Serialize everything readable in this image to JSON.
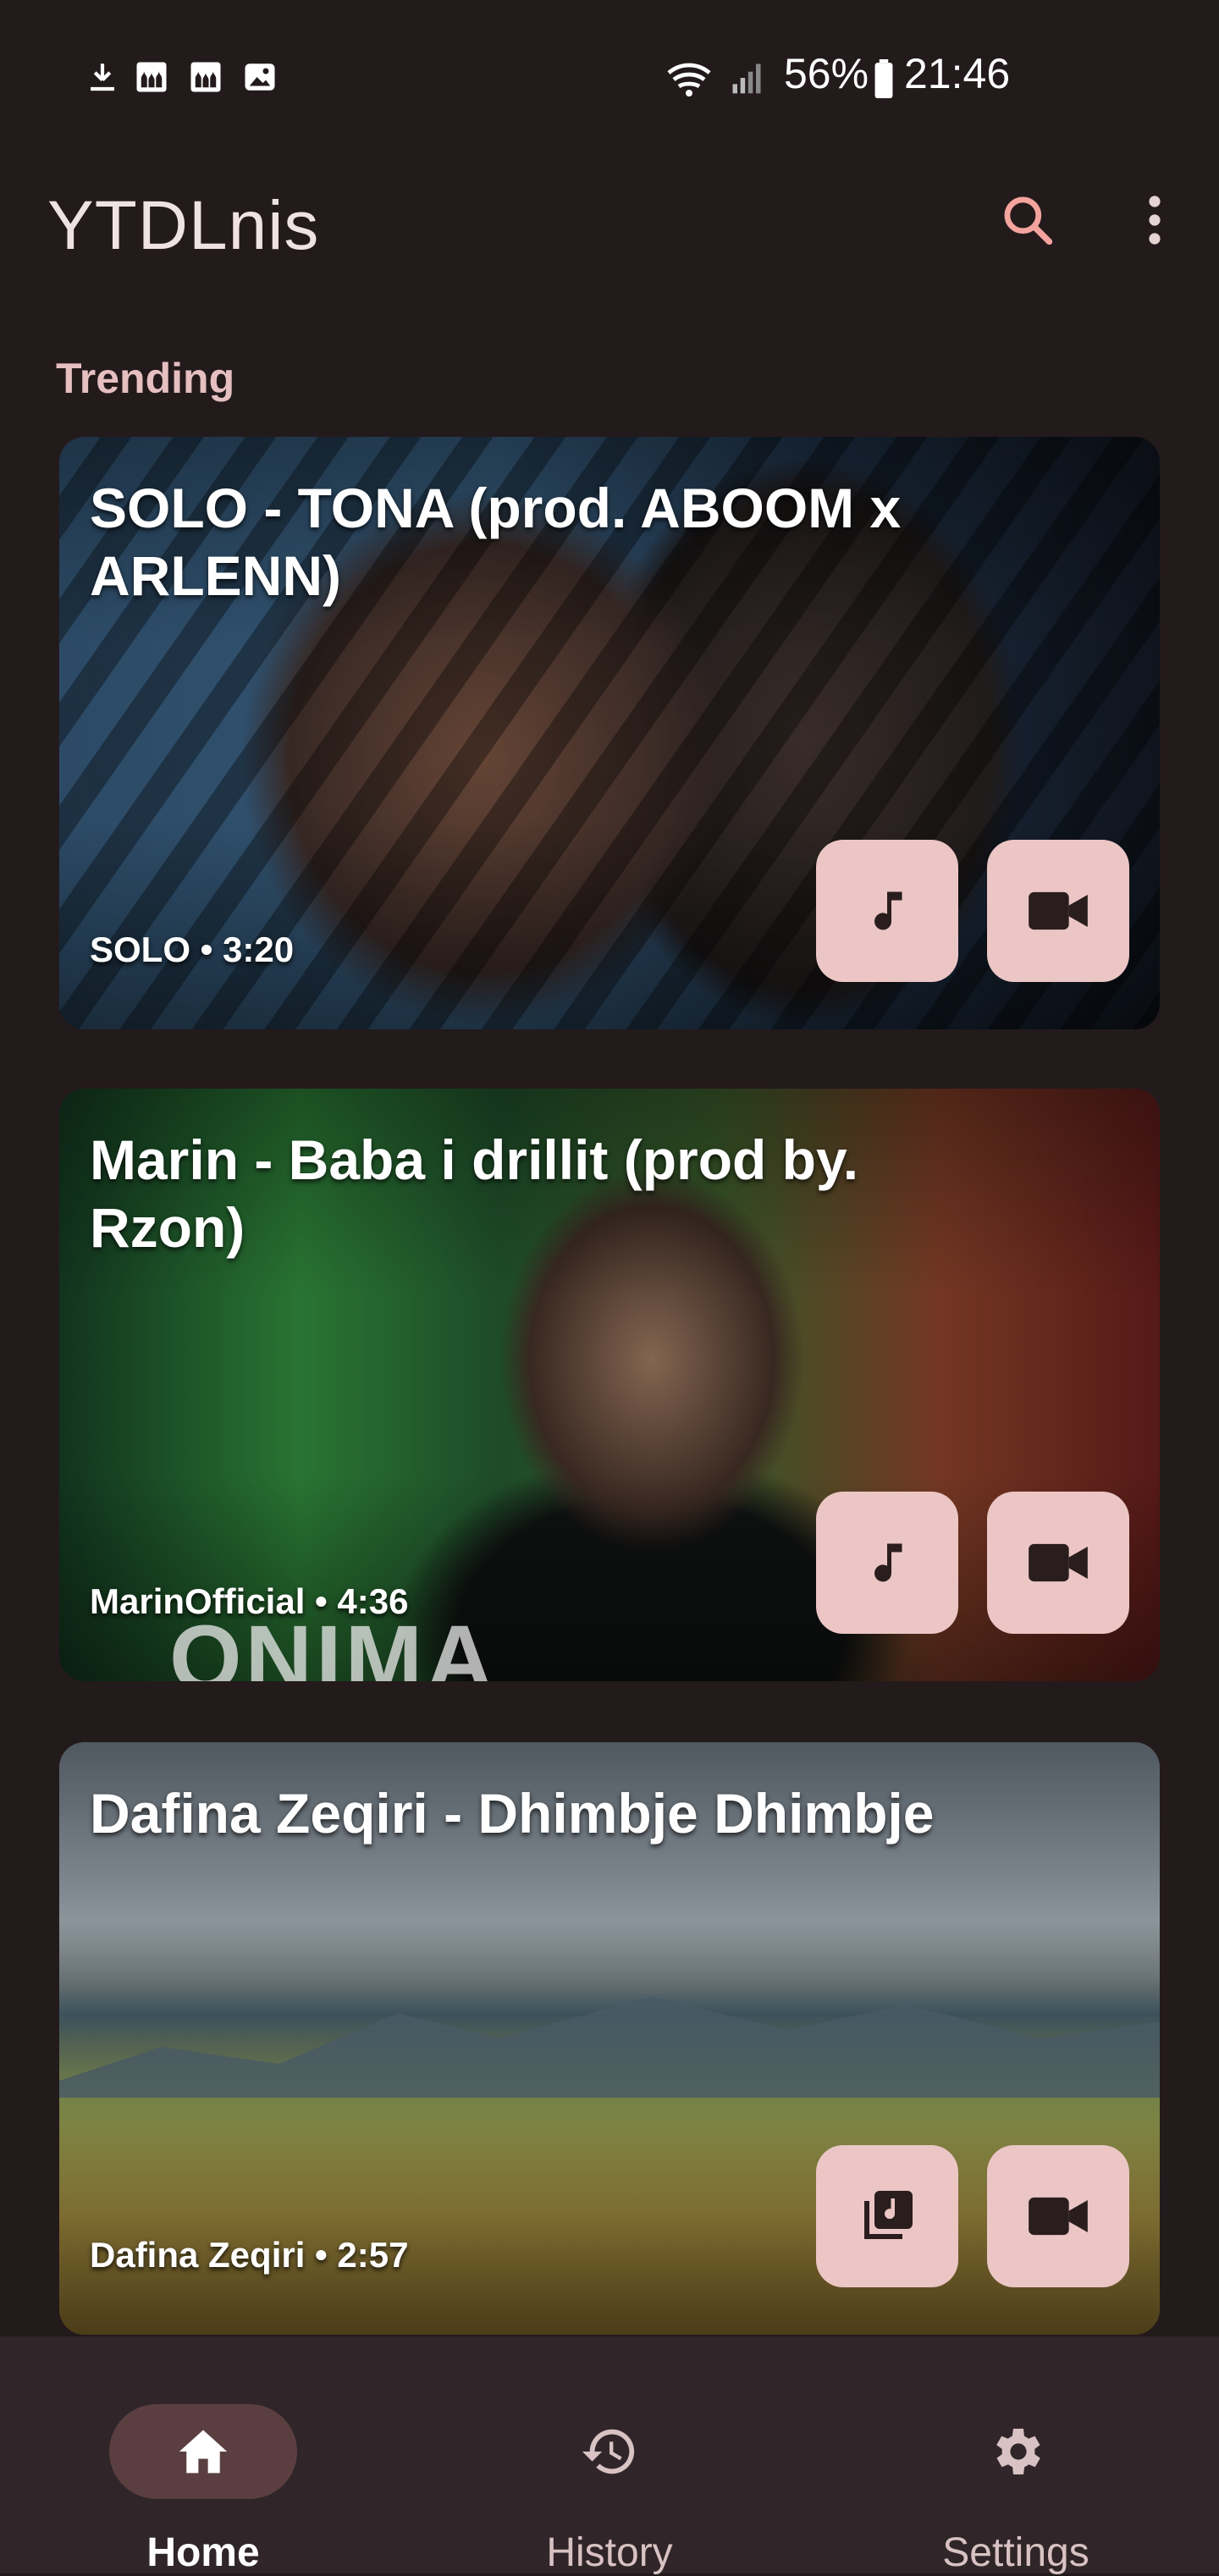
{
  "status_bar": {
    "battery": "56%",
    "time": "21:46",
    "icons": [
      "download-icon",
      "notification-mosque-icon",
      "notification-mosque-icon",
      "image-icon",
      "wifi-icon",
      "signal-icon",
      "battery-icon"
    ]
  },
  "app_bar": {
    "title": "YTDLnis",
    "search_icon": "search-icon",
    "menu_icon": "more-vert-icon"
  },
  "section": {
    "title": "Trending"
  },
  "cards": [
    {
      "title": "SOLO - TONA (prod. ABOOM x ARLENN)",
      "meta": "SOLO • 3:20",
      "audio_icon": "music-note-icon",
      "video_icon": "videocam-icon"
    },
    {
      "title": "Marin - Baba i drillit (prod by. Rzon)",
      "meta": "MarinOfficial • 4:36",
      "audio_icon": "music-note-icon",
      "video_icon": "videocam-icon"
    },
    {
      "title": "Dafina Zeqiri - Dhimbje Dhimbje",
      "meta": "Dafina Zeqiri • 2:57",
      "audio_icon": "music-library-icon",
      "video_icon": "videocam-icon"
    }
  ],
  "bottom_nav": {
    "items": [
      {
        "label": "Home",
        "icon": "home-icon",
        "active": true
      },
      {
        "label": "History",
        "icon": "history-icon",
        "active": false
      },
      {
        "label": "Settings",
        "icon": "settings-icon",
        "active": false
      }
    ]
  },
  "colors": {
    "background": "#231a1b",
    "accent": "#ebc6c4",
    "accent_icon": "#f4a39d",
    "section_title": "#e6bfc1",
    "nav_background": "#30262a",
    "nav_active_pill": "#5b3f40"
  }
}
